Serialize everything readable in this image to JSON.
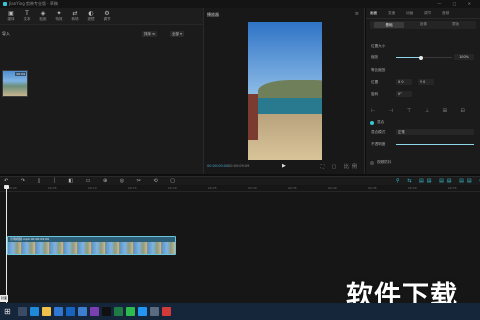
{
  "window": {
    "title": "JianYing 剪映专业版 · 草稿",
    "controls": "— □ ✕"
  },
  "toolbar": {
    "tools": [
      {
        "icon": "▣",
        "label": "媒体",
        "name": "media-icon"
      },
      {
        "icon": "T",
        "label": "文本",
        "name": "text-icon"
      },
      {
        "icon": "◈",
        "label": "贴纸",
        "name": "sticker-icon"
      },
      {
        "icon": "✦",
        "label": "特效",
        "name": "effects-icon"
      },
      {
        "icon": "⇄",
        "label": "转场",
        "name": "transition-icon"
      },
      {
        "icon": "◐",
        "label": "滤镜",
        "name": "filter-icon"
      },
      {
        "icon": "⚙",
        "label": "调节",
        "name": "adjust-icon"
      }
    ]
  },
  "media": {
    "side_label": "导入",
    "filter_sort": "排序 ≡",
    "filter_all": "全部 ▾",
    "thumb_duration": "00:09"
  },
  "player": {
    "title": "播放器",
    "menu": "≡",
    "timecode_current": "00:00:00:00",
    "timecode_total": "00:00:09:09",
    "play": "▶",
    "right_controls": "⛶ ▢ 比例"
  },
  "inspector": {
    "tabs": [
      "画面",
      "变速",
      "动画",
      "调节",
      "音频"
    ],
    "subtabs": [
      "基础",
      "抠像",
      "蒙版"
    ],
    "rows": {
      "scale_label": "缩放",
      "scale_value": "100%",
      "position_label": "位置",
      "pos_x": "X  0",
      "pos_y": "Y  0",
      "rotate_label": "旋转",
      "rotate_value": "0°",
      "section_label": "位置大小",
      "uniform_label": "等比缩放",
      "mix_label": "混合",
      "mode_label": "混合模式",
      "mode_value": "正常",
      "opacity_label": "不透明度",
      "stabilize_label": "视频防抖"
    },
    "scale_level": 0.45,
    "opacity_level": 1.0
  },
  "timeline": {
    "toolbar_icons": "↶ ↷ ▯ ⏐ ◧ ▭ ⊕ ◎ ✂ ⟲ ▢",
    "right_tools": "⚲ ⇆ ▤▤ ▤▤ ▤▤ ⊖ ⊕",
    "ruler": [
      "00:00",
      "00:05",
      "00:10",
      "00:15",
      "00:20",
      "00:25",
      "00:30",
      "00:35",
      "00:40",
      "00:45",
      "00:50",
      "00:55"
    ],
    "clip_label": "示例视频.mp4  00:00:09:09",
    "cover_label": "封面"
  },
  "watermark": "软件下载",
  "colors": {
    "accent": "#36c6d6",
    "clip": "#2d5f78",
    "taskbar": "#15253a"
  },
  "taskbar": {
    "start": "⊞",
    "apps": [
      {
        "name": "search-taskbar-icon",
        "color": "#3a4b63"
      },
      {
        "name": "edge-taskbar-icon",
        "color": "#1f8ad8"
      },
      {
        "name": "explorer-taskbar-icon",
        "color": "#f0c14b"
      },
      {
        "name": "store-taskbar-icon",
        "color": "#2f77d1"
      },
      {
        "name": "mail-taskbar-icon",
        "color": "#1565c0"
      },
      {
        "name": "photos-taskbar-icon",
        "color": "#3d7ecf"
      },
      {
        "name": "video-taskbar-icon",
        "color": "#7b3fb2"
      },
      {
        "name": "capcut-taskbar-icon",
        "color": "#101010"
      },
      {
        "name": "excel-taskbar-icon",
        "color": "#1f7a45"
      },
      {
        "name": "wechat-taskbar-icon",
        "color": "#2dbb4e"
      },
      {
        "name": "qq-taskbar-icon",
        "color": "#2196f3"
      },
      {
        "name": "settings-taskbar-icon",
        "color": "#5a6b80"
      },
      {
        "name": "music-taskbar-icon",
        "color": "#d33a3a"
      }
    ]
  }
}
